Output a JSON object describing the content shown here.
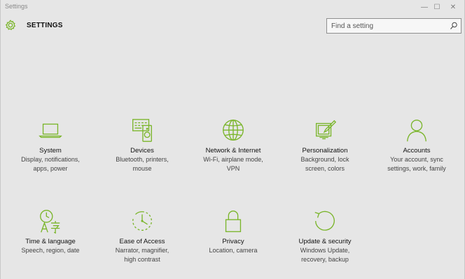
{
  "window": {
    "title": "Settings",
    "minimize_glyph": "—",
    "maximize_glyph": "☐",
    "close_glyph": "✕"
  },
  "header": {
    "title": "SETTINGS",
    "icon": "gear-icon"
  },
  "search": {
    "placeholder": "Find a setting",
    "value": "",
    "icon": "search-icon"
  },
  "accent_color": "#7ab52a",
  "tiles": [
    {
      "label": "System",
      "desc1": "Display, notifications,",
      "desc2": "apps, power",
      "icon": "laptop-icon"
    },
    {
      "label": "Devices",
      "desc1": "Bluetooth, printers,",
      "desc2": "mouse",
      "icon": "devices-icon"
    },
    {
      "label": "Network & Internet",
      "desc1": "Wi-Fi, airplane mode,",
      "desc2": "VPN",
      "icon": "globe-icon"
    },
    {
      "label": "Personalization",
      "desc1": "Background, lock",
      "desc2": "screen, colors",
      "icon": "personalization-icon"
    },
    {
      "label": "Accounts",
      "desc1": "Your account, sync",
      "desc2": "settings, work, family",
      "icon": "person-icon"
    },
    {
      "label": "Time & language",
      "desc1": "Speech, region, date",
      "desc2": "",
      "icon": "time-language-icon"
    },
    {
      "label": "Ease of Access",
      "desc1": "Narrator, magnifier,",
      "desc2": "high contrast",
      "icon": "ease-of-access-icon"
    },
    {
      "label": "Privacy",
      "desc1": "Location, camera",
      "desc2": "",
      "icon": "lock-icon"
    },
    {
      "label": "Update & security",
      "desc1": "Windows Update,",
      "desc2": "recovery, backup",
      "icon": "update-icon"
    }
  ]
}
